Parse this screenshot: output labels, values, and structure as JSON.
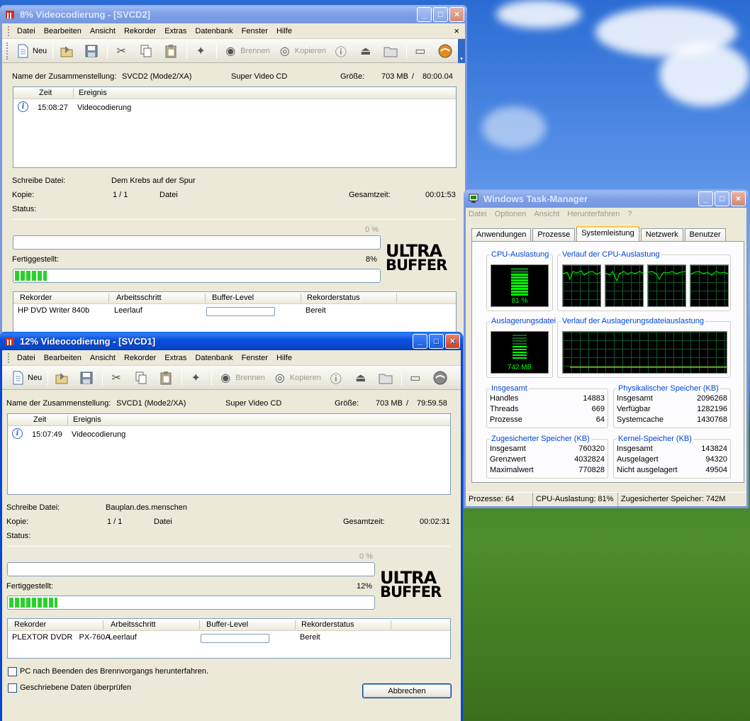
{
  "windows": {
    "svcd2": {
      "title": "8% Videocodierung - [SVCD2]",
      "menu": [
        "Datei",
        "Bearbeiten",
        "Ansicht",
        "Rekorder",
        "Extras",
        "Datenbank",
        "Fenster",
        "Hilfe"
      ],
      "mdi_close": "×",
      "toolbar": {
        "new": "Neu",
        "burn": "Brennen",
        "copy": "Kopieren"
      },
      "compilation_label": "Name der Zusammenstellung:",
      "compilation_name": "SVCD2 (Mode2/XA)",
      "compilation_type": "Super Video CD",
      "size_label": "Größe:",
      "size_value": "703 MB",
      "size_sep": "/",
      "size_time": "80:00.04",
      "log_headers": {
        "time": "Zeit",
        "event": "Ereignis"
      },
      "log_rows": [
        {
          "time": "15:08:27",
          "event": "Videocodierung"
        }
      ],
      "write_file_label": "Schreibe Datei:",
      "write_file_value": "Dem Krebs auf der Spur",
      "copy_label": "Kopie:",
      "copy_value": "1 / 1",
      "copy_unit": "Datei",
      "total_time_label": "Gesamtzeit:",
      "total_time_value": "00:01:53",
      "status_label": "Status:",
      "file_progress_text": "0 %",
      "file_progress": 0,
      "done_label": "Fertiggestellt:",
      "done_percent": "8%",
      "done_progress": 0.08,
      "logo_top": "ULTRA",
      "logo_bottom": "BUFFER",
      "rec_headers": {
        "recorder": "Rekorder",
        "step": "Arbeitsschritt",
        "buffer": "Buffer-Level",
        "status": "Rekorderstatus"
      },
      "rec_row": {
        "recorder": "HP DVD Writer 840b",
        "step": "Leerlauf",
        "status": "Bereit"
      }
    },
    "svcd1": {
      "title": "12% Videocodierung - [SVCD1]",
      "menu": [
        "Datei",
        "Bearbeiten",
        "Ansicht",
        "Rekorder",
        "Extras",
        "Datenbank",
        "Fenster",
        "Hilfe"
      ],
      "toolbar": {
        "new": "Neu",
        "burn": "Brennen",
        "copy": "Kopieren"
      },
      "compilation_label": "Name der Zusammenstellung:",
      "compilation_name": "SVCD1 (Mode2/XA)",
      "compilation_type": "Super Video CD",
      "size_label": "Größe:",
      "size_value": "703 MB",
      "size_sep": "/",
      "size_time": "79:59.58",
      "log_headers": {
        "time": "Zeit",
        "event": "Ereignis"
      },
      "log_rows": [
        {
          "time": "15:07:49",
          "event": "Videocodierung"
        }
      ],
      "write_file_label": "Schreibe Datei:",
      "write_file_value": "Bauplan.des.menschen",
      "copy_label": "Kopie:",
      "copy_value": "1 / 1",
      "copy_unit": "Datei",
      "total_time_label": "Gesamtzeit:",
      "total_time_value": "00:02:31",
      "status_label": "Status:",
      "file_progress_text": "0 %",
      "file_progress": 0,
      "done_label": "Fertiggestellt:",
      "done_percent": "12%",
      "done_progress": 0.12,
      "logo_top": "ULTRA",
      "logo_bottom": "BUFFER",
      "rec_headers": {
        "recorder": "Rekorder",
        "step": "Arbeitsschritt",
        "buffer": "Buffer-Level",
        "status": "Rekorderstatus"
      },
      "rec_row": {
        "recorder": "PLEXTOR DVDR   PX-760A",
        "step": "Leerlauf",
        "status": "Bereit"
      },
      "shutdown_checkbox": "PC nach Beenden des Brennvorgangs herunterfahren.",
      "verify_checkbox": "Geschriebene Daten überprüfen",
      "cancel_button": "Abbrechen"
    },
    "taskmgr": {
      "title": "Windows Task-Manager",
      "menu": [
        "Datei",
        "Optionen",
        "Ansicht",
        "Herunterfahren",
        "?"
      ],
      "tabs": [
        "Anwendungen",
        "Prozesse",
        "Systemleistung",
        "Netzwerk",
        "Benutzer"
      ],
      "active_tab": 2,
      "cpu_usage_title": "CPU-Auslastung",
      "cpu_usage_value": "81 %",
      "cpu_usage": 0.81,
      "cpu_history_title": "Verlauf der CPU-Auslastung",
      "pagefile_title": "Auslagerungsdatei",
      "pagefile_value": "742 MB",
      "pagefile_history_title": "Verlauf der Auslagerungsdateiauslastung",
      "totals": {
        "title": "Insgesamt",
        "rows": [
          [
            "Handles",
            "14883"
          ],
          [
            "Threads",
            "669"
          ],
          [
            "Prozesse",
            "64"
          ]
        ]
      },
      "physical": {
        "title": "Physikalischer Speicher (KB)",
        "rows": [
          [
            "Insgesamt",
            "2096268"
          ],
          [
            "Verfügbar",
            "1282196"
          ],
          [
            "Systemcache",
            "1430768"
          ]
        ]
      },
      "commit": {
        "title": "Zugesicherter Speicher (KB)",
        "rows": [
          [
            "Insgesamt",
            "760320"
          ],
          [
            "Grenzwert",
            "4032824"
          ],
          [
            "Maximalwert",
            "770828"
          ]
        ]
      },
      "kernel": {
        "title": "Kernel-Speicher (KB)",
        "rows": [
          [
            "Insgesamt",
            "143824"
          ],
          [
            "Ausgelagert",
            "94320"
          ],
          [
            "Nicht ausgelagert",
            "49504"
          ]
        ]
      },
      "status": {
        "processes": "Prozesse: 64",
        "cpu": "CPU-Auslastung: 81%",
        "commit": "Zugesicherter Speicher: 742M"
      }
    }
  },
  "colors": {
    "xp_blue": "#0a47cf",
    "progress_green": "#2bd12b",
    "graph_green": "#00ff00",
    "group_title": "#0046d5"
  }
}
